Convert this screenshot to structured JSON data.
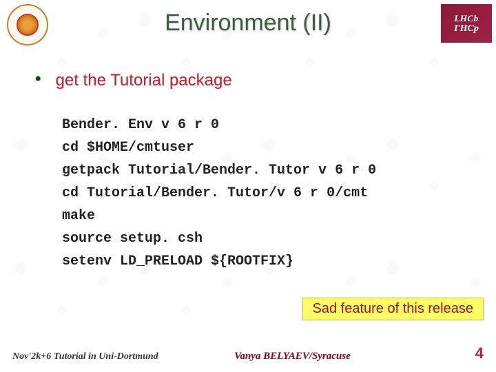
{
  "title": "Environment (II)",
  "logoLeftAlt": "Syracuse University seal",
  "logoRight": {
    "line1": "LHCb",
    "line2": "ГНСр"
  },
  "bullet": {
    "marker": "•",
    "text": "get the Tutorial package"
  },
  "code": "Bender. Env v 6 r 0\ncd $HOME/cmtuser\ngetpack Tutorial/Bender. Tutor v 6 r 0\ncd Tutorial/Bender. Tutor/v 6 r 0/cmt\nmake\nsource setup. csh\nsetenv LD_PRELOAD ${ROOTFIX}",
  "note": "Sad feature of this release",
  "footer": {
    "left": "Nov'2k+6  Tutorial in Uni-Dortmund",
    "center": "Vanya  BELYAEV/Syracuse",
    "right": "4"
  }
}
